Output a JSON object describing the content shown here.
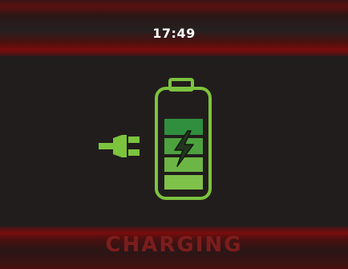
{
  "status_bar": {
    "time": "17:49"
  },
  "footer": {
    "status_label": "CHARGING"
  },
  "charging_indicator": {
    "icons": [
      "plug-icon",
      "battery-icon",
      "lightning-bolt-icon"
    ],
    "level_segments": 4,
    "colors": {
      "outline": "#7cc33e",
      "segment_top": "#2f8f3e",
      "segment_mid": "#4da23f",
      "segment_low": "#6cb646",
      "segment_bottom": "#7fc24a",
      "accent_red": "#7c1d1d"
    }
  }
}
